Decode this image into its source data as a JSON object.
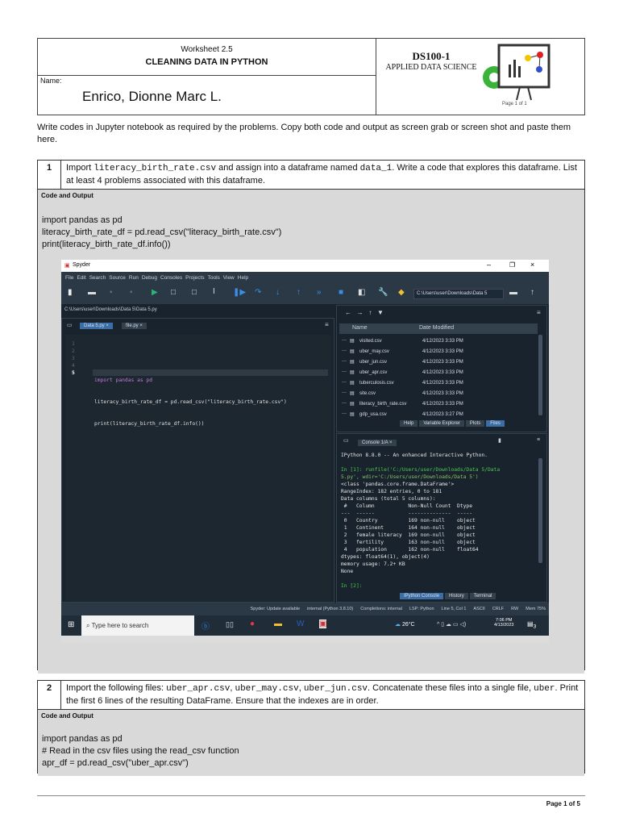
{
  "header": {
    "worksheet": "Worksheet 2.5",
    "title": "CLEANING DATA IN PYTHON",
    "name_label": "Name:",
    "name": "Enrico, Dionne Marc L.",
    "course_code": "DS100-1",
    "course_name": "APPLIED DATA SCIENCE",
    "logo_page": "Page 1 of 1"
  },
  "intro": "Write codes in Jupyter notebook as required by the problems. Copy both code and output as screen grab or screen shot and paste them here.",
  "p1": {
    "num": "1",
    "t1": "Import ",
    "c1": "literacy_birth_rate.csv",
    "t2": " and assign into a dataframe named ",
    "c2": "data_1",
    "t3": ". Write a code that explores this dataframe. List at least 4 problems associated with this dataframe.",
    "label": "Code and Output",
    "code": [
      "import pandas as pd",
      "literacy_birth_rate_df = pd.read_csv(\"literacy_birth_rate.csv\")",
      "print(literacy_birth_rate_df.info())"
    ]
  },
  "p2": {
    "num": "2",
    "t1": "Import the following files: ",
    "c1": "uber_apr.csv",
    "t2": ", ",
    "c2": "uber_may.csv",
    "t3": ", ",
    "c3": "uber_jun.csv",
    "t4": ". Concatenate these files into a single file, ",
    "c4": "uber",
    "t5": ". Print the first 6 lines of the resulting DataFrame. Ensure that the indexes are in order.",
    "label": "Code and Output",
    "code": [
      "import pandas as pd",
      "# Read in the csv files using the read_csv function",
      "apr_df = pd.read_csv(\"uber_apr.csv\")"
    ]
  },
  "footer": "Page 1 of 5",
  "spyder": {
    "title": "Spyder",
    "menu": [
      "File",
      "Edit",
      "Search",
      "Source",
      "Run",
      "Debug",
      "Consoles",
      "Projects",
      "Tools",
      "View",
      "Help"
    ],
    "path": "C:\\Users\\user\\Downloads\\Data 5\\Data 5.py",
    "wd": "C:\\Users\\user\\Downloads\\Data 5",
    "tabs": [
      "Data 5.py ×",
      "file.py ×"
    ],
    "line_numbers": [
      "1",
      "2",
      "3",
      "4",
      "5"
    ],
    "editor_lines": [
      "",
      "import pandas as pd",
      "literacy_birth_rate_df = pd.read_csv(\"literacy_birth_rate.csv\")",
      "print(literacy_birth_rate_df.info())",
      ""
    ],
    "files_header": [
      "Name",
      "Date Modified"
    ],
    "files": [
      [
        "visited.csv",
        "4/12/2023 3:33 PM"
      ],
      [
        "uber_may.csv",
        "4/12/2023 3:33 PM"
      ],
      [
        "uber_jun.csv",
        "4/12/2023 3:33 PM"
      ],
      [
        "uber_apr.csv",
        "4/12/2023 3:33 PM"
      ],
      [
        "tuberculosis.csv",
        "4/12/2023 3:33 PM"
      ],
      [
        "site.csv",
        "4/12/2023 3:33 PM"
      ],
      [
        "literacy_birth_rate.csv",
        "4/12/2023 3:33 PM"
      ],
      [
        "gdp_usa.csv",
        "4/12/2023 3:27 PM"
      ]
    ],
    "pane_tabs": [
      "Help",
      "Variable Explorer",
      "Plots",
      "Files"
    ],
    "console_tab": "Console 1/A ×",
    "console": [
      "IPython 8.8.0 -- An enhanced Interactive Python.",
      "",
      "In [1]: runfile('C:/Users/user/Downloads/Data 5/Data",
      "5.py', wdir='C:/Users/user/Downloads/Data 5')",
      "<class 'pandas.core.frame.DataFrame'>",
      "RangeIndex: 182 entries, 0 to 181",
      "Data columns (total 5 columns):",
      " #   Column           Non-Null Count  Dtype",
      "---  ------           --------------  -----",
      " 0   Country          169 non-null    object",
      " 1   Continent        164 non-null    object",
      " 2   female literacy  169 non-null    object",
      " 3   fertility        163 non-null    object",
      " 4   population       162 non-null    float64",
      "dtypes: float64(1), object(4)",
      "memory usage: 7.2+ KB",
      "None",
      "",
      "In [2]:"
    ],
    "console_tabs": [
      "IPython Console",
      "History",
      "Terminal"
    ],
    "status": [
      "Spyder: Update available",
      "internal (Python 3.8.10)",
      "Completions: internal",
      "LSP: Python",
      "Line 5, Col 1",
      "ASCII",
      "CRLF",
      "RW",
      "Mem 75%"
    ],
    "taskbar": {
      "search": "Type here to search",
      "temp": "26°C",
      "time": "7:06 PM",
      "date": "4/13/2023",
      "notif": "3"
    }
  }
}
